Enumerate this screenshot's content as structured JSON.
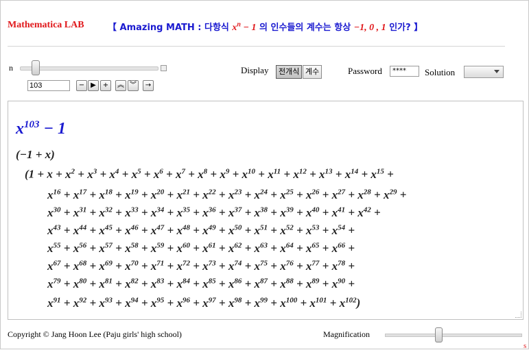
{
  "header": {
    "brand": "Mathematica LAB",
    "question_open": "【 Amazing MATH : 다항식 ",
    "question_math_base": "x",
    "question_math_exp": "n",
    "question_math_rest": " − 1",
    "question_mid": " 의 인수들의 계수는 항상 ",
    "question_values": "−1, 0 , 1",
    "question_close": " 인가? 】"
  },
  "controls": {
    "n_label": "n",
    "n_value": 103,
    "n_value_text": "103",
    "buttons": [
      "−",
      "▶",
      "+",
      "︽",
      "︾",
      "→"
    ],
    "display_label": "Display",
    "display_options": [
      "전개식",
      "계수"
    ],
    "display_selected": "전개식",
    "password_label": "Password",
    "password_value": "****",
    "solution_label": "Solution",
    "solution_value": ""
  },
  "output": {
    "lhs_base": "x",
    "lhs_exp": "103",
    "lhs_rest": " − 1",
    "factor1": "(−1 + x)",
    "factor2_open": "(1 + x",
    "factor2_close": ")",
    "last_exponent": 102,
    "line_breaks_after": [
      15,
      29,
      42,
      54,
      66,
      78,
      90,
      102
    ]
  },
  "footer": {
    "copyright": "Copyright © Jang Hoon Lee (Paju girls' high school)",
    "magnification_label": "Magnification"
  },
  "colors": {
    "brand_red": "#e0181b",
    "math_blue": "#1a1ad0"
  }
}
